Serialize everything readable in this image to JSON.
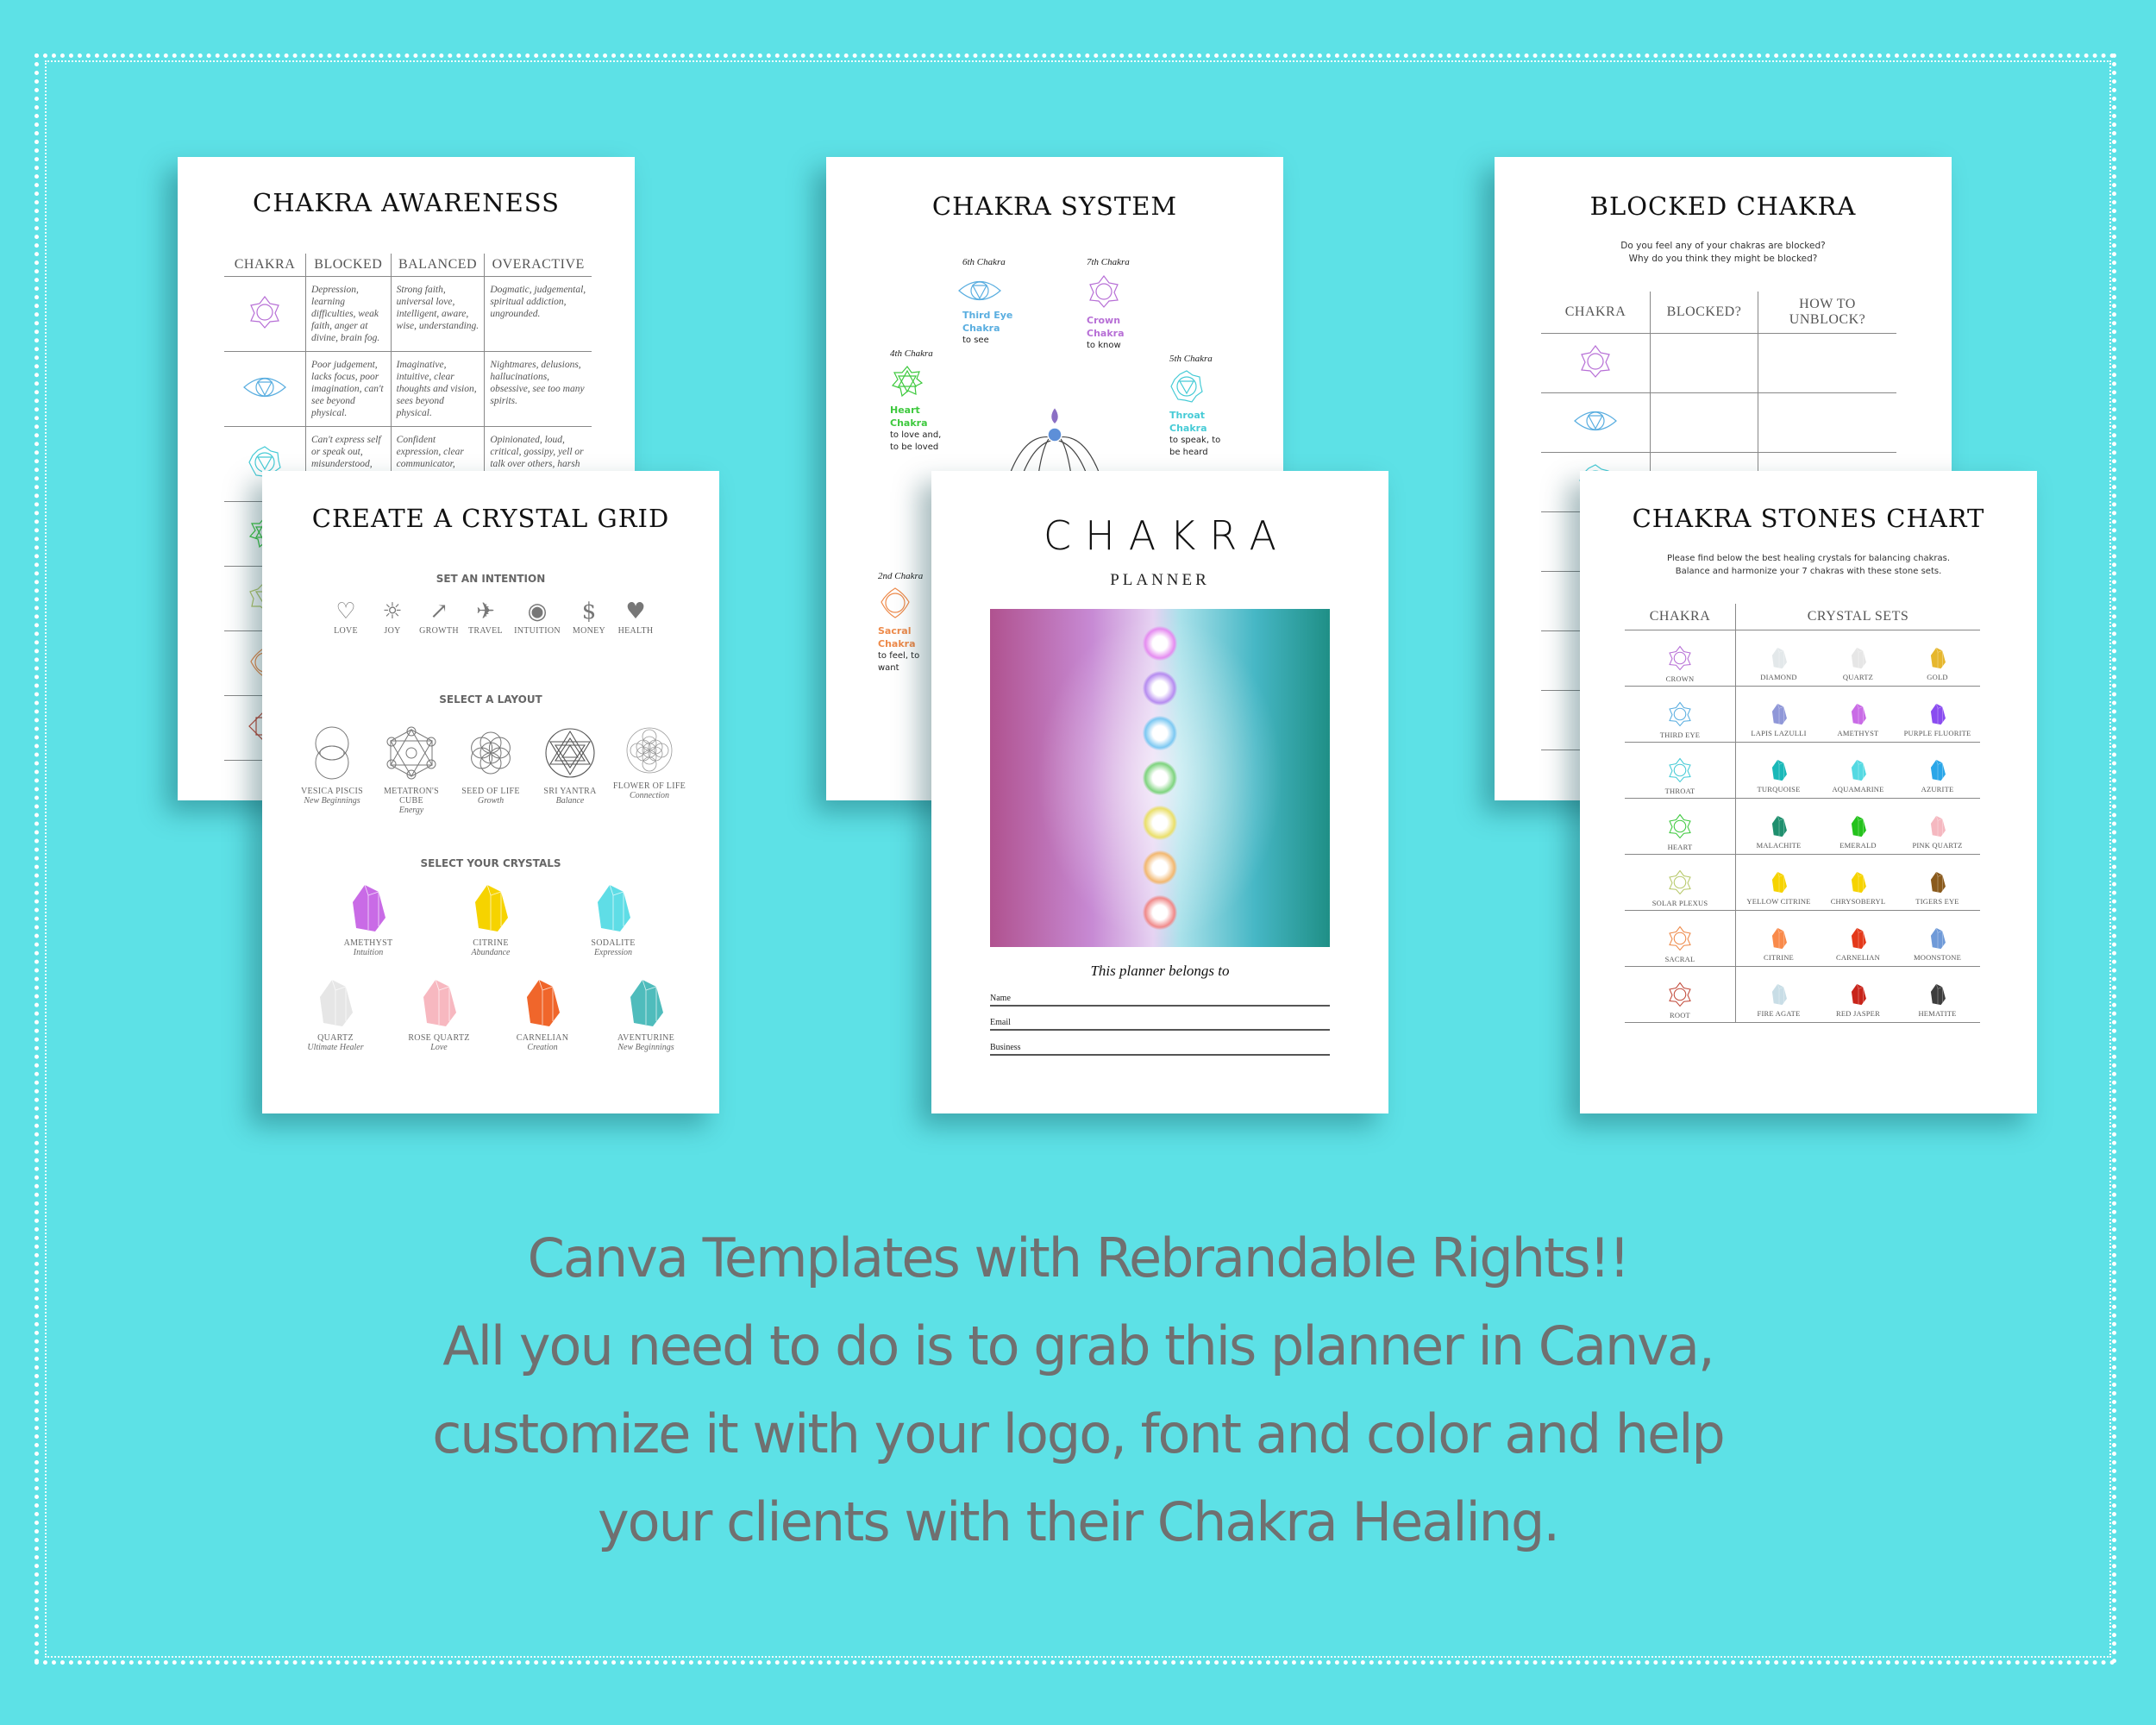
{
  "colors": {
    "background": "#5de1e6",
    "caption": "#707070"
  },
  "awareness": {
    "title": "CHAKRA AWARENESS",
    "headers": [
      "CHAKRA",
      "BLOCKED",
      "BALANCED",
      "OVERACTIVE"
    ],
    "rows": [
      {
        "chakra": "crown",
        "color": "#b76fd6",
        "blocked": "Depression, learning difficulties, weak faith, anger at divine, brain fog.",
        "balanced": "Strong faith, universal love, intelligent, aware, wise, understanding.",
        "overactive": "Dogmatic, judgemental, spiritual addiction, ungrounded."
      },
      {
        "chakra": "third-eye",
        "color": "#5aaee0",
        "blocked": "Poor judgement, lacks focus, poor imagination, can't see beyond physical.",
        "balanced": "Imaginative, intuitive, clear thoughts and vision, sees beyond physical.",
        "overactive": "Nightmares, delusions, hallucinations, obsessive, see too many spirits."
      },
      {
        "chakra": "throat",
        "color": "#46cbd6",
        "blocked": "Can't express self or speak out, misunderstood, secritive, not a good listener.",
        "balanced": "Confident expression, clear communicator, creative, diplomatic.",
        "overactive": "Opinionated, loud, critical, gossipy, yell or talk over others, harsh words."
      }
    ]
  },
  "system": {
    "title": "CHAKRA SYSTEM",
    "items": [
      {
        "num": "6th Chakra",
        "name": "Third Eye Chakra",
        "desc": "to see",
        "color": "#5aaee0"
      },
      {
        "num": "7th Chakra",
        "name": "Crown Chakra",
        "desc": "to know",
        "color": "#b76fd6"
      },
      {
        "num": "4th Chakra",
        "name": "Heart Chakra",
        "desc": "to love and, to be loved",
        "color": "#3ec93e"
      },
      {
        "num": "5th Chakra",
        "name": "Throat Chakra",
        "desc": "to speak, to be heard",
        "color": "#46cbd6"
      },
      {
        "num": "2nd Chakra",
        "name": "Sacral Chakra",
        "desc": "to feel, to want",
        "color": "#ee8a4a"
      }
    ]
  },
  "blocked": {
    "title": "BLOCKED CHAKRA",
    "subtitle_1": "Do you feel any of your chakras are blocked?",
    "subtitle_2": "Why do you think they might be blocked?",
    "headers": [
      "CHAKRA",
      "BLOCKED?",
      "HOW TO UNBLOCK?"
    ]
  },
  "grid": {
    "title": "CREATE A CRYSTAL GRID",
    "intention_head": "SET AN INTENTION",
    "intentions": [
      {
        "icon": "heart-icon",
        "glyph": "♡",
        "label": "LOVE"
      },
      {
        "icon": "sun-icon",
        "glyph": "☼",
        "label": "JOY"
      },
      {
        "icon": "growth-arrow-icon",
        "glyph": "↗",
        "label": "GROWTH"
      },
      {
        "icon": "paper-plane-icon",
        "glyph": "✈",
        "label": "TRAVEL"
      },
      {
        "icon": "eye-icon",
        "glyph": "◉",
        "label": "INTUITION"
      },
      {
        "icon": "dollar-coin-icon",
        "glyph": "$",
        "label": "MONEY"
      },
      {
        "icon": "hands-heart-icon",
        "glyph": "♥",
        "label": "HEALTH"
      }
    ],
    "layout_head": "SELECT A LAYOUT",
    "layouts": [
      {
        "label": "VESICA PISCIS",
        "sub": "New Beginnings"
      },
      {
        "label": "METATRON'S CUBE",
        "sub": "Energy"
      },
      {
        "label": "SEED OF LIFE",
        "sub": "Growth"
      },
      {
        "label": "SRI YANTRA",
        "sub": "Balance"
      },
      {
        "label": "FLOWER OF LIFE",
        "sub": "Connection"
      }
    ],
    "crystal_head": "SELECT YOUR CRYSTALS",
    "crystals_row1": [
      {
        "label": "AMETHYST",
        "sub": "Intuition",
        "color": "#c96be6"
      },
      {
        "label": "CITRINE",
        "sub": "Abundance",
        "color": "#f6d300"
      },
      {
        "label": "SODALITE",
        "sub": "Expression",
        "color": "#5fdde6"
      }
    ],
    "crystals_row2": [
      {
        "label": "QUARTZ",
        "sub": "Ultimate Healer",
        "color": "#e6e6e6"
      },
      {
        "label": "ROSE QUARTZ",
        "sub": "Love",
        "color": "#f7b8c0"
      },
      {
        "label": "CARNELIAN",
        "sub": "Creation",
        "color": "#f0662b"
      },
      {
        "label": "AVENTURINE",
        "sub": "New Beginnings",
        "color": "#4fbcbc"
      }
    ]
  },
  "cover": {
    "title": "CHAKRA",
    "subtitle": "PLANNER",
    "belongs": "This planner belongs to",
    "fields": [
      "Name",
      "Email",
      "Business"
    ],
    "orb_colors": [
      "#e58cf0",
      "#b68cf0",
      "#7cc8f2",
      "#7fd47f",
      "#eadf6a",
      "#f2b871",
      "#f08a8a"
    ]
  },
  "stones": {
    "title": "CHAKRA STONES CHART",
    "subtitle_1": "Please find below the best healing crystals for balancing chakras.",
    "subtitle_2": "Balance and harmonize your 7 chakras with these stone sets.",
    "headers": [
      "CHAKRA",
      "CRYSTAL SETS"
    ],
    "rows": [
      {
        "chakra": "CROWN",
        "color": "#b76fd6",
        "stones": [
          {
            "name": "DIAMOND",
            "color": "#e3e8ea"
          },
          {
            "name": "QUARTZ",
            "color": "#e6e6e6"
          },
          {
            "name": "GOLD",
            "color": "#e6b72e"
          }
        ]
      },
      {
        "chakra": "THIRD EYE",
        "color": "#5aaee0",
        "stones": [
          {
            "name": "LAPIS LAZULLI",
            "color": "#8f97d8"
          },
          {
            "name": "AMETHYST",
            "color": "#c96be6"
          },
          {
            "name": "PURPLE FLUORITE",
            "color": "#8a4cf0"
          }
        ]
      },
      {
        "chakra": "THROAT",
        "color": "#46cbd6",
        "stones": [
          {
            "name": "TURQUOISE",
            "color": "#19b8b8"
          },
          {
            "name": "AQUAMARINE",
            "color": "#55d9e2"
          },
          {
            "name": "AZURITE",
            "color": "#2aa6e8"
          }
        ]
      },
      {
        "chakra": "HEART",
        "color": "#3ec93e",
        "stones": [
          {
            "name": "MALACHITE",
            "color": "#1f8f6e"
          },
          {
            "name": "EMERALD",
            "color": "#24c21c"
          },
          {
            "name": "PINK QUARTZ",
            "color": "#f5b8c0"
          }
        ]
      },
      {
        "chakra": "SOLAR PLEXUS",
        "color": "#b7c96a",
        "stones": [
          {
            "name": "YELLOW CITRINE",
            "color": "#f6d300"
          },
          {
            "name": "CHRYSOBERYL",
            "color": "#f6d300"
          },
          {
            "name": "TIGERS EYE",
            "color": "#8a5a1c"
          }
        ]
      },
      {
        "chakra": "SACRAL",
        "color": "#ee8a4a",
        "stones": [
          {
            "name": "CITRINE",
            "color": "#f98a4a"
          },
          {
            "name": "CARNELIAN",
            "color": "#e4391a"
          },
          {
            "name": "MOONSTONE",
            "color": "#6f9ad8"
          }
        ]
      },
      {
        "chakra": "ROOT",
        "color": "#c24a3a",
        "stones": [
          {
            "name": "FIRE AGATE",
            "color": "#c8dde6"
          },
          {
            "name": "RED JASPER",
            "color": "#c8241a"
          },
          {
            "name": "HEMATITE",
            "color": "#3d3d3d"
          }
        ]
      }
    ]
  },
  "caption": {
    "lines": [
      "Canva Templates with Rebrandable Rights!!",
      "All you need to do is to grab this planner in Canva,",
      "customize it with your logo, font and color and help",
      "your clients with their Chakra Healing."
    ]
  }
}
